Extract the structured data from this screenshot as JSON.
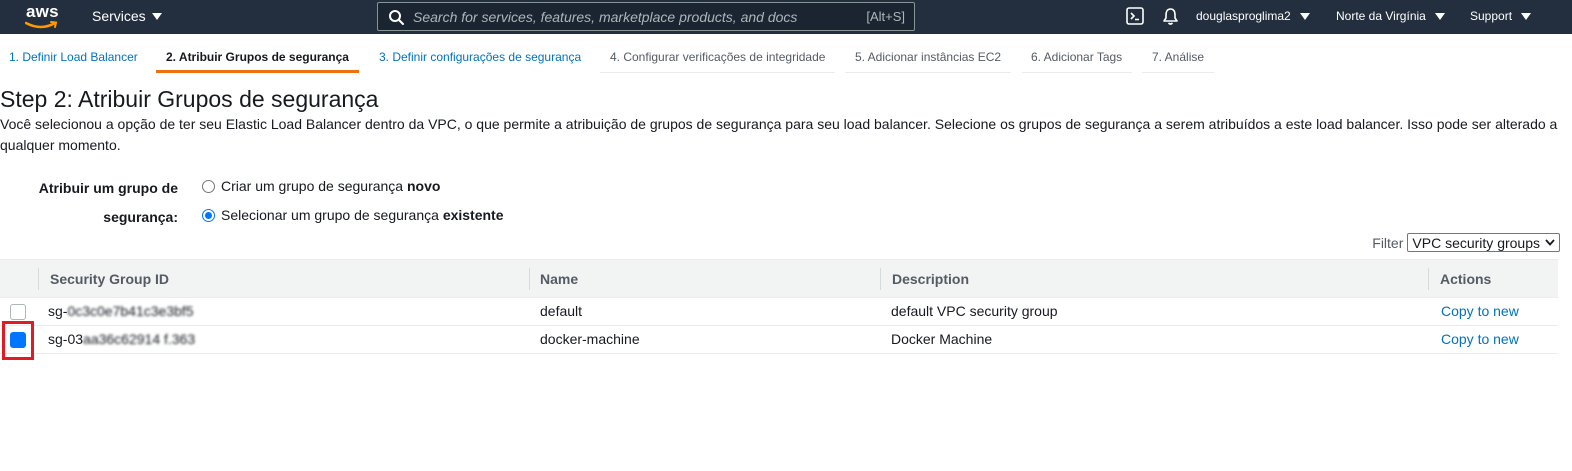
{
  "topnav": {
    "logo_text": "aws",
    "services_label": "Services",
    "search_placeholder": "Search for services, features, marketplace products, and docs",
    "search_shortcut": "[Alt+S]",
    "user": "douglasproglima2",
    "region": "Norte da Virgínia",
    "support": "Support"
  },
  "tabs": [
    {
      "label": "1. Definir Load Balancer"
    },
    {
      "label": "2. Atribuir Grupos de segurança"
    },
    {
      "label": "3. Definir configurações de segurança"
    },
    {
      "label": "4. Configurar verificações de integridade"
    },
    {
      "label": "5. Adicionar instâncias EC2"
    },
    {
      "label": "6. Adicionar Tags"
    },
    {
      "label": "7. Análise"
    }
  ],
  "page": {
    "title": "Step 2: Atribuir Grupos de segurança",
    "description": "Você selecionou a opção de ter seu Elastic Load Balancer dentro da VPC, o que permite a atribuição de grupos de segurança para seu load balancer. Selecione os grupos de segurança a serem atribuídos a este load balancer. Isso pode ser alterado a qualquer momento."
  },
  "assign": {
    "label_line1": "Atribuir um grupo de",
    "label_line2": "segurança:",
    "option_new_prefix": "Criar um grupo de segurança ",
    "option_new_bold": "novo",
    "option_existing_prefix": "Selecionar um grupo de segurança ",
    "option_existing_bold": "existente",
    "selected": "existente"
  },
  "filter": {
    "label": "Filter",
    "value": "VPC security groups"
  },
  "table": {
    "headers": {
      "id": "Security Group ID",
      "name": "Name",
      "description": "Description",
      "actions": "Actions"
    },
    "rows": [
      {
        "id_visible": "sg-",
        "id_obscured": "0c3c0e7b41c3e3bf5",
        "name": "default",
        "description": "default VPC security group",
        "action": "Copy to new",
        "checked": false
      },
      {
        "id_visible": "sg-03",
        "id_obscured": "aa36c62914 f.363",
        "name": "docker-machine",
        "description": "Docker Machine",
        "action": "Copy to new",
        "checked": true
      }
    ]
  },
  "colors": {
    "nav_bg": "#232f3e",
    "link": "#0073bb",
    "active_tab": "#ec7211",
    "highlight": "#e01b24"
  }
}
